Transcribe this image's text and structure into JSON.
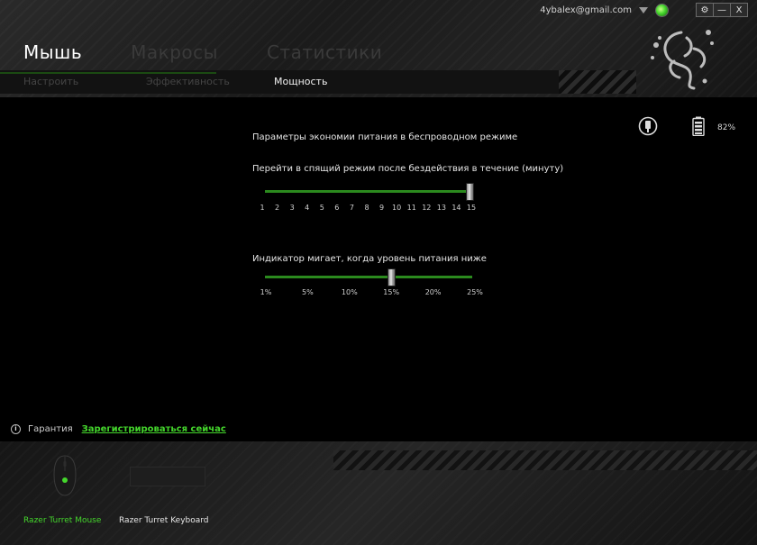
{
  "topbar": {
    "user_email": "4ybalex@gmail.com",
    "icons": [
      "dropdown-caret-icon",
      "status-orb-icon"
    ],
    "window_buttons": {
      "settings": "⚙",
      "minimize": "—",
      "close": "X"
    }
  },
  "main_tabs": [
    {
      "label": "Мышь",
      "active": true
    },
    {
      "label": "Макросы",
      "active": false
    },
    {
      "label": "Статистики",
      "active": false
    }
  ],
  "sub_tabs": [
    {
      "label": "Настроить",
      "active": false
    },
    {
      "label": "Эффективность",
      "active": false
    },
    {
      "label": "Мощность",
      "active": true
    }
  ],
  "status": {
    "battery_percent": "82%",
    "icons": [
      "power-plug-icon",
      "battery-icon"
    ]
  },
  "power": {
    "section_title": "Параметры экономии питания в беспроводном режиме",
    "sleep_label": "Перейти в спящий режим после бездействия в течение (минуту)",
    "sleep_ticks": [
      "1",
      "2",
      "3",
      "4",
      "5",
      "6",
      "7",
      "8",
      "9",
      "10",
      "11",
      "12",
      "13",
      "14",
      "15"
    ],
    "sleep_value": 15,
    "blink_label": "Индикатор мигает, когда уровень питания ниже",
    "blink_ticks": [
      "1%",
      "5%",
      "10%",
      "15%",
      "20%",
      "25%"
    ],
    "blink_value": "15%"
  },
  "warranty": {
    "label": "Гарантия",
    "link": "Зарегистрироваться сейчас"
  },
  "devices": [
    {
      "name": "Razer Turret Mouse",
      "active": true
    },
    {
      "name": "Razer Turret Keyboard",
      "active": false
    }
  ],
  "colors": {
    "accent": "#44d62c",
    "slider_track": "#2b8a1e",
    "background": "#000000"
  }
}
